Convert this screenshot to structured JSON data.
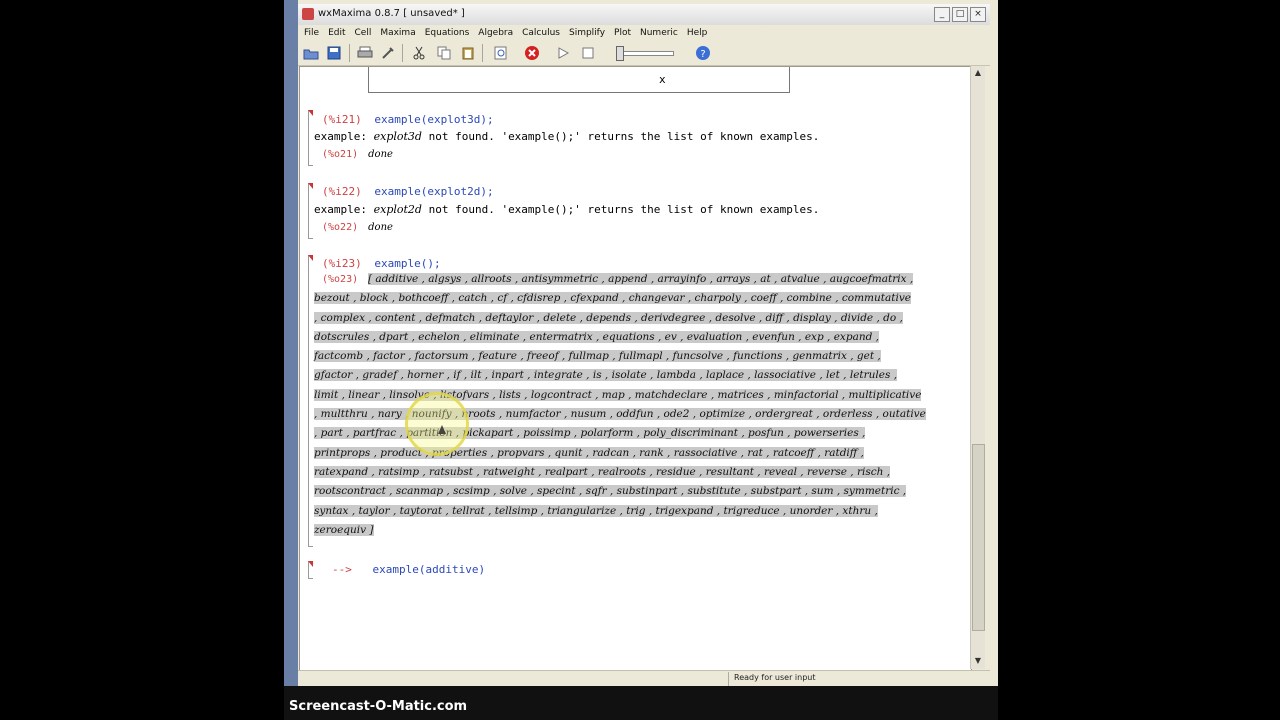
{
  "window": {
    "title": "wxMaxima 0.8.7 [ unsaved* ]"
  },
  "window_buttons": [
    "_",
    "□",
    "×"
  ],
  "menu": [
    "File",
    "Edit",
    "Cell",
    "Maxima",
    "Equations",
    "Algebra",
    "Calculus",
    "Simplify",
    "Plot",
    "Numeric",
    "Help"
  ],
  "toolbar": {
    "icons": [
      "open-icon",
      "save-icon",
      "print-icon",
      "preferences-icon",
      "cut-icon",
      "copy-icon",
      "paste-icon",
      "find-icon",
      "interrupt-icon",
      "play-icon",
      "stop-icon",
      "help-icon"
    ]
  },
  "plot_output": {
    "label": "x"
  },
  "cells": [
    {
      "in_label": "(%i21)",
      "command": "example(explot3d);",
      "message_prefix": "example:",
      "message_name": "explot3d",
      "message_suffix": "not found. 'example();' returns the list of known examples.",
      "out_label": "(%o21)",
      "out_value": "done"
    },
    {
      "in_label": "(%i22)",
      "command": "example(explot2d);",
      "message_prefix": "example:",
      "message_name": "explot2d",
      "message_suffix": "not found. 'example();' returns the list of known examples.",
      "out_label": "(%o22)",
      "out_value": "done"
    },
    {
      "in_label": "(%i23)",
      "command": "example();",
      "out_label": "(%o23)"
    }
  ],
  "examples_list": [
    "[ additive , algsys , allroots , antisymmetric , append , arrayinfo , arrays , at , atvalue , augcoefmatrix ,",
    "bezout , block , bothcoeff , catch , cf , cfdisrep , cfexpand , changevar , charpoly , coeff , combine , commutative",
    ", complex , content , defmatch , deftaylor , delete , depends , derivdegree , desolve , diff , display , divide , do ,",
    "dotscrules , dpart , echelon , eliminate , entermatrix , equations , ev , evaluation , evenfun , exp , expand ,",
    "factcomb , factor , factorsum , feature , freeof , fullmap , fullmapl , funcsolve , functions , genmatrix , get ,",
    "gfactor , gradef , horner , if , ilt , inpart , integrate , is , isolate , lambda , laplace , lassociative , let , letrules ,",
    "limit , linear , linsolve , listofvars , lists , logcontract , map , matchdeclare , matrices , minfactorial , multiplicative",
    ", multthru , nary , nounify , nroots , numfactor , nusum , oddfun , ode2 , optimize , ordergreat , orderless , outative",
    ", part , partfrac , partition , pickapart , poissimp , polarform , poly_discriminant , posfun , powerseries ,",
    "printprops , product , properties , propvars , qunit , radcan , rank , rassociative , rat , ratcoeff , ratdiff ,",
    "ratexpand , ratsimp , ratsubst , ratweight , realpart , realroots , residue , resultant , reveal , reverse , risch ,",
    "rootscontract , scanmap , scsimp , solve , specint , sqfr , substinpart , substitute , substpart , sum , symmetric ,",
    "syntax , taylor , taytorat , tellrat , tellsimp , triangularize , trig , trigexpand , trigreduce , unorder , xthru ,",
    "zeroequiv ]"
  ],
  "input_cell": {
    "prompt": "-->",
    "command": "example(additive)"
  },
  "status": {
    "text": "Ready for user input"
  },
  "watermark": {
    "text": "Screencast-O-Matic.com"
  }
}
